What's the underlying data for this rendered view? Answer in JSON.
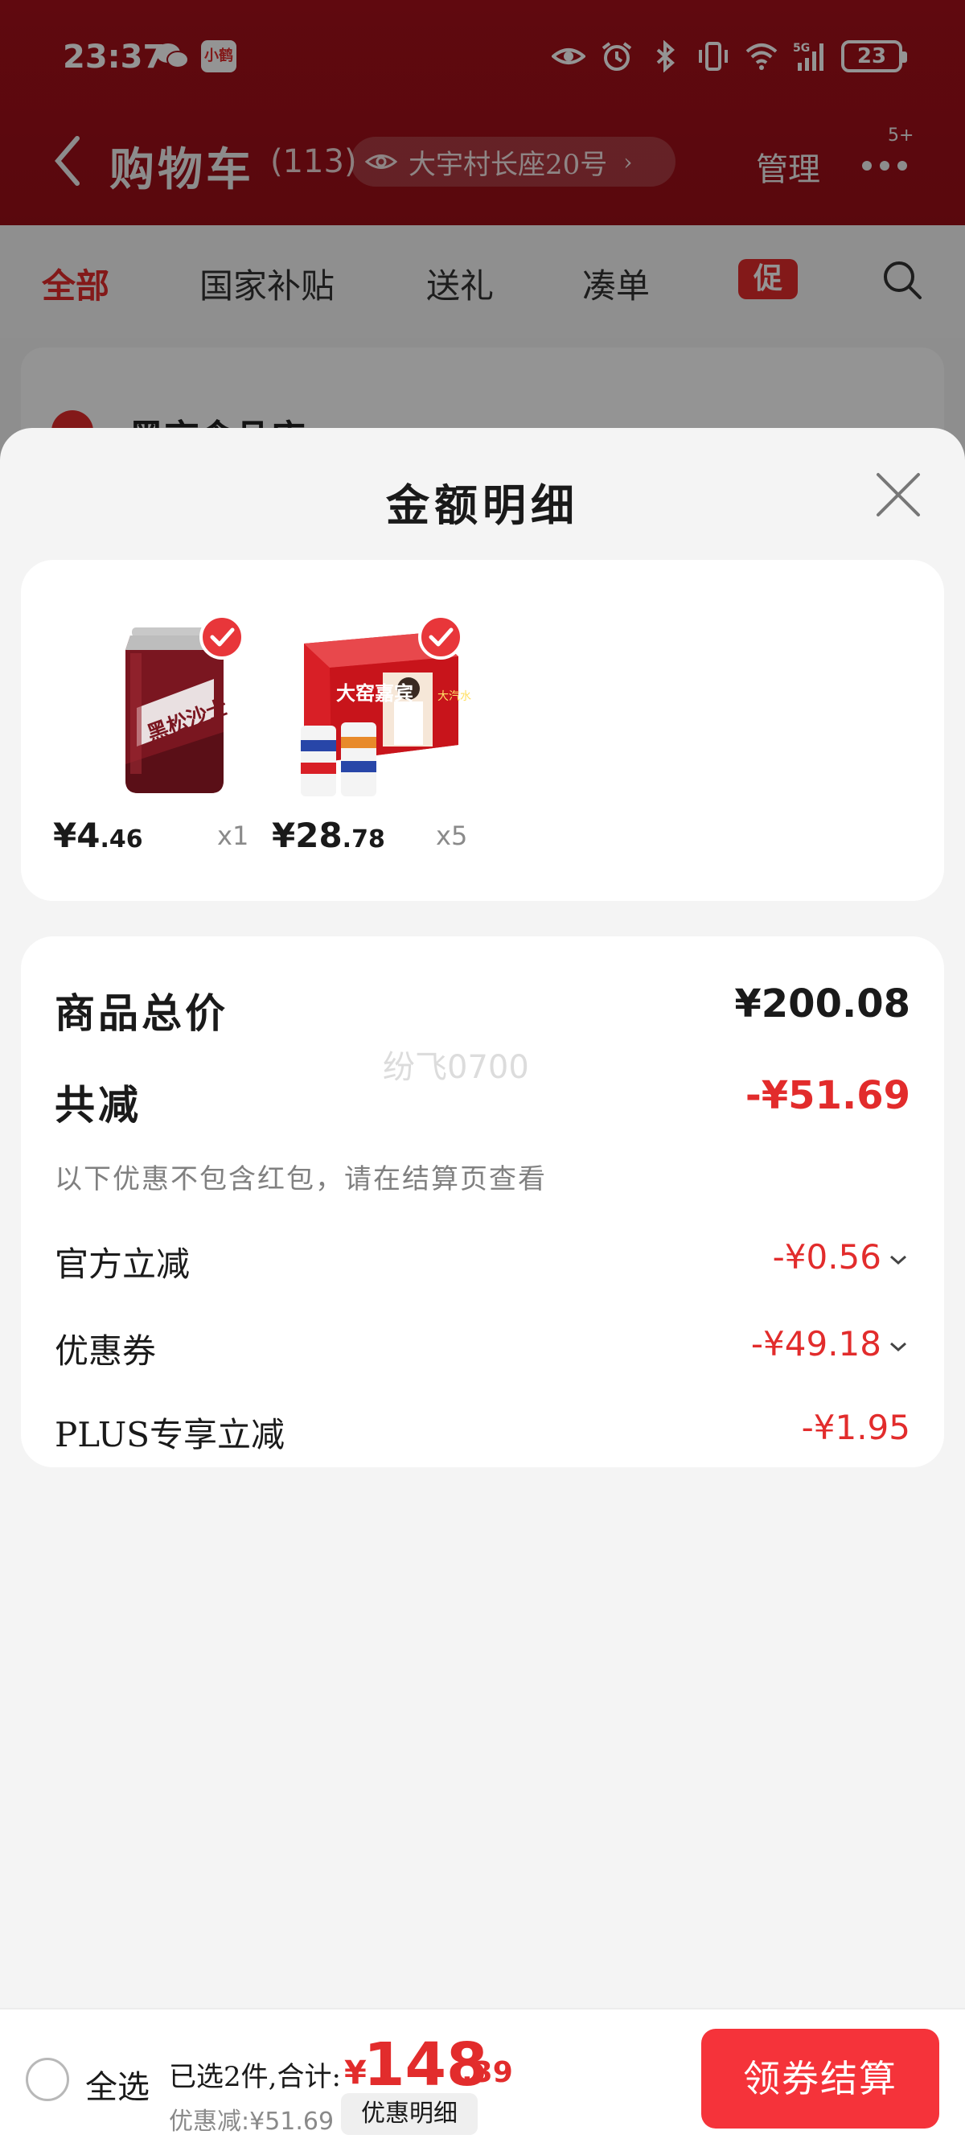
{
  "status_bar": {
    "time": "23:37",
    "left_icons": [
      "wechat-icon",
      "app-xiaohe-icon"
    ],
    "app_icon_label": "小鹤",
    "right_icons": [
      "eye-icon",
      "alarm-icon",
      "bluetooth-icon",
      "vibrate-icon",
      "wifi-icon",
      "5g-signal-icon"
    ],
    "battery": "23"
  },
  "cart_header": {
    "title": "购物车",
    "count": "(113)",
    "address": "大宇村长座20号",
    "manage": "管理",
    "more_badge": "5+"
  },
  "tabs": [
    {
      "label": "全部",
      "active": true
    },
    {
      "label": "国家补贴",
      "active": false
    },
    {
      "label": "送礼",
      "active": false
    },
    {
      "label": "凑单",
      "active": false
    }
  ],
  "promo_tag": "促",
  "store": {
    "name": "黑京食品店 ›"
  },
  "sheet": {
    "title": "金额明细",
    "watermark": "纷飞0700",
    "items": [
      {
        "price_main": "¥4",
        "price_cents": ".46",
        "qty": "x1",
        "image": "black-soda-can"
      },
      {
        "price_main": "¥28",
        "price_cents": ".78",
        "qty": "x5",
        "image": "dayao-gift-box"
      }
    ],
    "summary": {
      "total_label": "商品总价",
      "total_value": "¥200.08",
      "reduce_label": "共减",
      "reduce_value": "-¥51.69",
      "hint": "以下优惠不包含红包，请在结算页查看",
      "rows": [
        {
          "label": "官方立减",
          "value": "-¥0.56",
          "expandable": true
        },
        {
          "label": "优惠券",
          "value": "-¥49.18",
          "expandable": true
        },
        {
          "label": "PLUS专享立减",
          "value": "-¥1.95",
          "expandable": false
        }
      ]
    }
  },
  "checkout": {
    "select_all": "全选",
    "selected_summary": "已选2件,合计:",
    "total_yen": "¥",
    "total_main": "148",
    "total_cents": ".39",
    "discount": "优惠减:¥51.69",
    "detail_chip": "优惠明细",
    "checkout_button": "领券结算"
  },
  "colors": {
    "brand_red": "#e22c2c",
    "header_red": "#a5101a",
    "checkout_red": "#f5333a"
  }
}
